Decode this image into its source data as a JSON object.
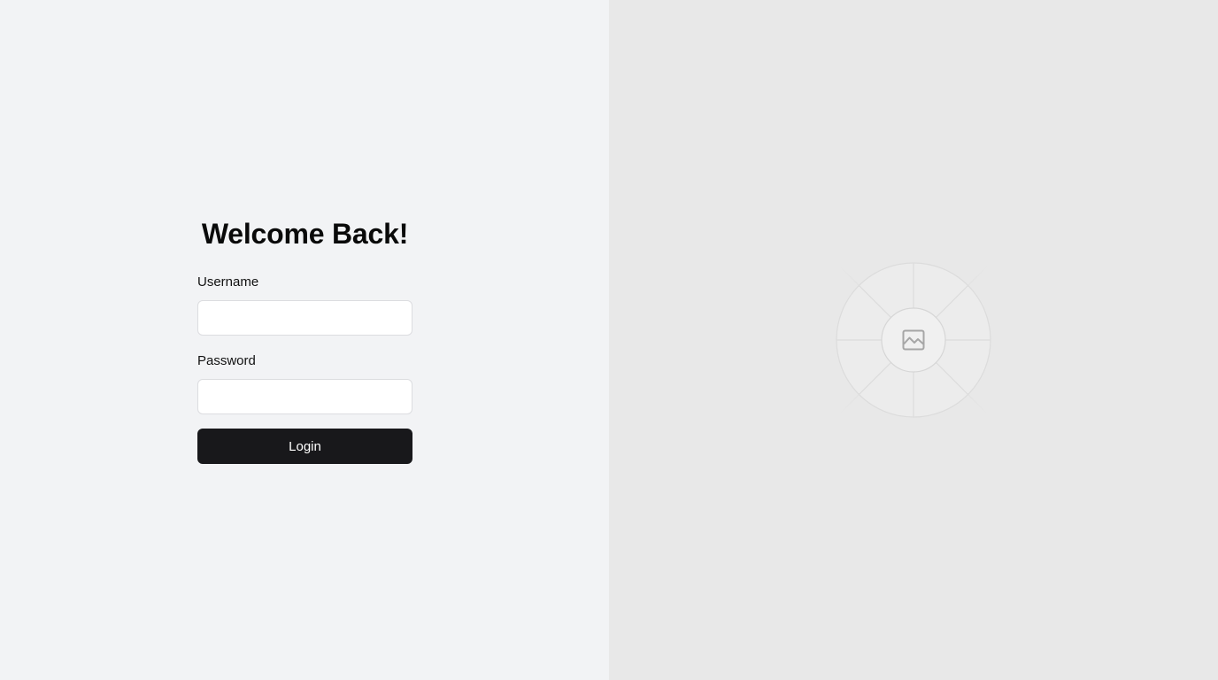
{
  "login": {
    "title": "Welcome Back!",
    "username_label": "Username",
    "username_value": "",
    "password_label": "Password",
    "password_value": "",
    "submit_label": "Login"
  },
  "illustration": {
    "icon": "image-icon"
  },
  "colors": {
    "left_background": "#f2f3f5",
    "right_background": "#e8e8e8",
    "button_background": "#18181b",
    "button_text": "#ffffff"
  }
}
